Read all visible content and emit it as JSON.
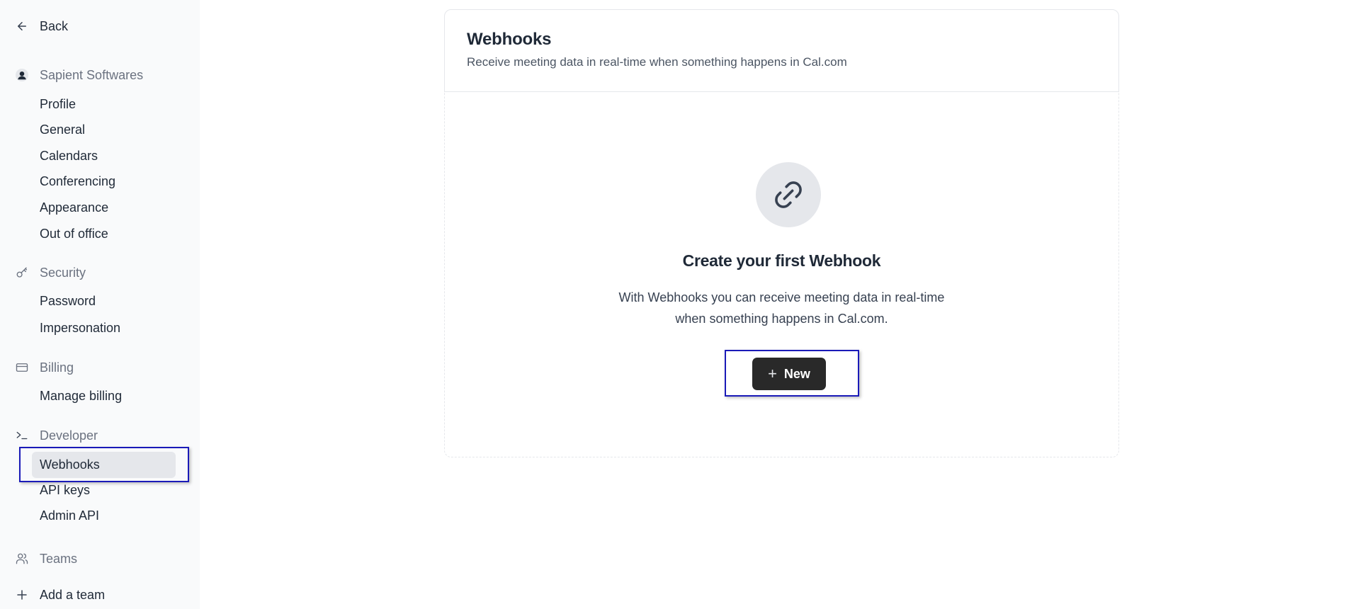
{
  "sidebar": {
    "back_label": "Back",
    "sections": [
      {
        "label": "Sapient Softwares",
        "icon": "user-avatar-icon",
        "items": [
          "Profile",
          "General",
          "Calendars",
          "Conferencing",
          "Appearance",
          "Out of office"
        ]
      },
      {
        "label": "Security",
        "icon": "key-icon",
        "items": [
          "Password",
          "Impersonation"
        ]
      },
      {
        "label": "Billing",
        "icon": "credit-card-icon",
        "items": [
          "Manage billing"
        ]
      },
      {
        "label": "Developer",
        "icon": "terminal-icon",
        "items": [
          "Webhooks",
          "API keys",
          "Admin API"
        ]
      },
      {
        "label": "Teams",
        "icon": "users-icon",
        "items": []
      }
    ],
    "active_item": "Webhooks",
    "add_team_label": "Add a team"
  },
  "main": {
    "title": "Webhooks",
    "subtitle": "Receive meeting data in real-time when something happens in Cal.com",
    "empty_state": {
      "icon": "link-icon",
      "title": "Create your first Webhook",
      "description": "With Webhooks you can receive meeting data in real-time when something happens in Cal.com.",
      "button_label": "New",
      "button_icon": "plus-icon"
    }
  },
  "colors": {
    "sidebar_bg": "#f9fafb",
    "active_bg": "#e5e7eb",
    "primary_button": "#292929",
    "highlight_border": "#1a1ab8"
  }
}
